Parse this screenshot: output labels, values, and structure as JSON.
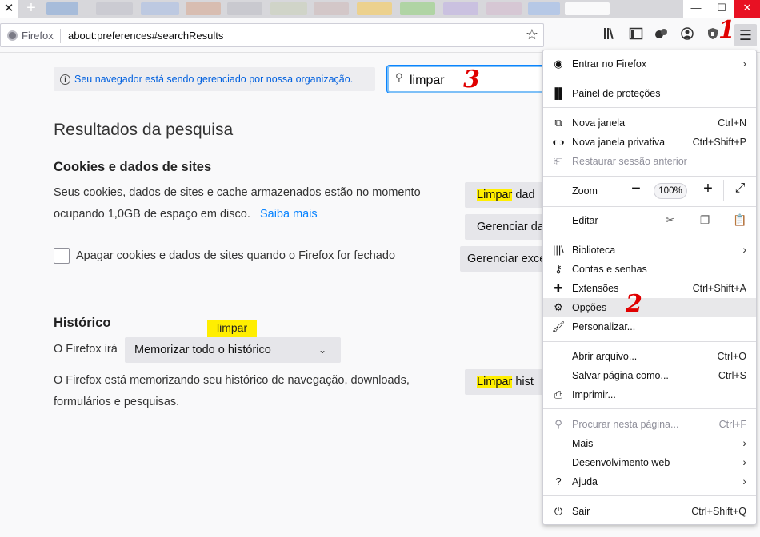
{
  "tabs": {
    "close_glyph": "✕",
    "new_glyph": "+",
    "min_glyph": "—",
    "max_glyph": "☐",
    "win_close_glyph": "✕"
  },
  "navbar": {
    "identity": "Firefox",
    "url": "about:preferences#searchResults"
  },
  "annotations": {
    "one": "1",
    "two": "2",
    "three": "3"
  },
  "policy": {
    "text": "Seu navegador está sendo gerenciado por nossa organização."
  },
  "search": {
    "value": "limpar"
  },
  "results": {
    "title": "Resultados da pesquisa"
  },
  "cookies": {
    "heading": "Cookies e dados de sites",
    "desc_line1": "Seus cookies, dados de sites e cache armazenados estão no momento",
    "desc_line2": "ocupando 1,0GB de espaço em disco.",
    "learn_more": "Saiba mais",
    "clear_btn_hl": "Limpar",
    "clear_btn_rest": " dad",
    "manage_btn": "Gerenciar da",
    "checkbox_label": "Apagar cookies e dados de sites quando o Firefox for fechado",
    "exceptions_btn": "Gerenciar exce"
  },
  "history": {
    "heading": "Histórico",
    "tooltip": "limpar",
    "label": "O Firefox irá",
    "select_value": "Memorizar todo o histórico",
    "desc_line1": "O Firefox está memorizando seu histórico de navegação, downloads,",
    "desc_line2": "formulários e pesquisas.",
    "clear_btn_hl": "Limpar",
    "clear_btn_rest": " hist"
  },
  "menu": {
    "sign_in": "Entrar no Firefox",
    "protections": "Painel de proteções",
    "new_window": {
      "label": "Nova janela",
      "shortcut": "Ctrl+N"
    },
    "private_window": {
      "label": "Nova janela privativa",
      "shortcut": "Ctrl+Shift+P"
    },
    "restore_session": "Restaurar sessão anterior",
    "zoom": {
      "label": "Zoom",
      "value": "100%"
    },
    "edit": "Editar",
    "library": "Biblioteca",
    "logins": "Contas e senhas",
    "addons": {
      "label": "Extensões",
      "shortcut": "Ctrl+Shift+A"
    },
    "options": "Opções",
    "customize": "Personalizar...",
    "open_file": {
      "label": "Abrir arquivo...",
      "shortcut": "Ctrl+O"
    },
    "save_page": {
      "label": "Salvar página como...",
      "shortcut": "Ctrl+S"
    },
    "print": "Imprimir...",
    "find": {
      "label": "Procurar nesta página...",
      "shortcut": "Ctrl+F"
    },
    "more": "Mais",
    "webdev": "Desenvolvimento web",
    "help": "Ajuda",
    "quit": {
      "label": "Sair",
      "shortcut": "Ctrl+Shift+Q"
    }
  },
  "colors": {
    "highlight": "#ffee00",
    "link": "#0a84ff",
    "annotation": "#e00000"
  }
}
